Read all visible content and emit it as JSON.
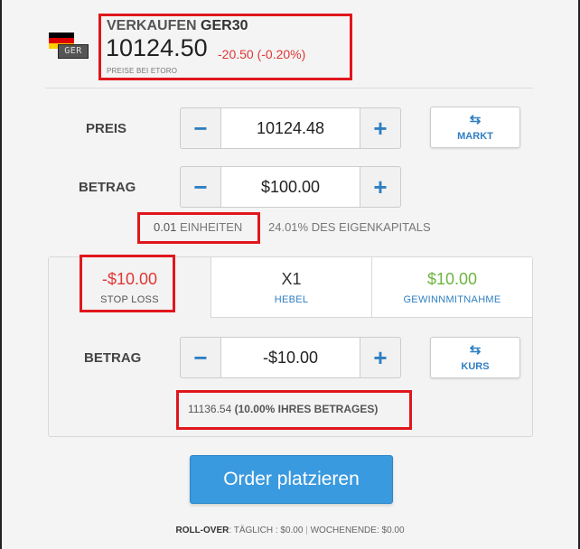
{
  "header": {
    "flag_tag": "GER",
    "action": "VERKAUFEN",
    "symbol": "GER30",
    "price": "10124.50",
    "change": "-20.50 (-0.20%)",
    "source": "PREISE BEI ETORO"
  },
  "rate_row": {
    "label": "PREIS",
    "value": "10124.48",
    "minus": "−",
    "plus": "+",
    "side_button": {
      "icon": "swap-arrows",
      "label": "MARKT"
    }
  },
  "amount_row": {
    "label": "BETRAG",
    "value": "$100.00",
    "minus": "−",
    "plus": "+"
  },
  "units": {
    "value": "0.01",
    "unit_label": "EINHEITEN",
    "equity": "24.01% DES EIGENKAPITALS"
  },
  "tabs": [
    {
      "value": "-$10.00",
      "label": "STOP LOSS",
      "selected": true
    },
    {
      "value": "X1",
      "label": "HEBEL",
      "selected": false
    },
    {
      "value": "$10.00",
      "label": "GEWINNMITNAHME",
      "selected": false
    }
  ],
  "sl_row": {
    "label": "BETRAG",
    "value": "-$10.00",
    "minus": "−",
    "plus": "+",
    "side_button": {
      "icon": "swap-arrows",
      "label": "KURS"
    }
  },
  "sl_info": {
    "rate": "11136.54",
    "detail": "(10.00% IHRES BETRAGES)"
  },
  "order_button": "Order platzieren",
  "footer": {
    "rollover_label": "ROLL-OVER",
    "daily": ": TÄGLICH : $0.00",
    "separator": "|",
    "weekend": "WOCHENENDE: $0.00"
  },
  "colors": {
    "accent": "#2f7fc1",
    "order_button": "#3a9ae0",
    "negative": "#e03636",
    "positive": "#6db33f",
    "highlight_box": "#e0161c"
  }
}
